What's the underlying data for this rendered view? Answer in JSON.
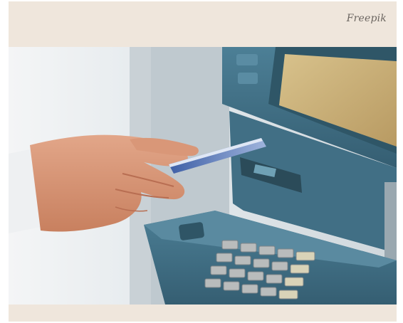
{
  "credit": {
    "text": "Freepik"
  },
  "photo": {
    "subject_icon": "atm-card-insert-icon",
    "colors": {
      "background": "#efe6dc",
      "atm_body": "#3f6f86",
      "screen": "#c8b07a",
      "skin": "#d89a7c",
      "card": "#4a6fb3"
    }
  }
}
